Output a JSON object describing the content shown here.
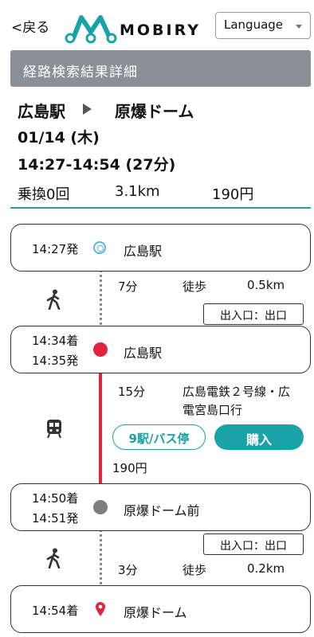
{
  "header": {
    "back_label": "<戻る",
    "brand": "MOBIRY",
    "language_label": "Language",
    "accent_color": "#19a2a8"
  },
  "title_bar": "経路検索結果詳細",
  "summary": {
    "from": "広島駅",
    "to": "原爆ドーム",
    "date": "01/14 (木)",
    "time_range": "14:27-14:54 (27分)",
    "transfers": "乗換0回",
    "distance": "3.1km",
    "fare": "190円"
  },
  "stops": [
    {
      "t1": "14:27発",
      "t2": "",
      "name": "広島駅",
      "marker": "origin-ring-icon"
    },
    {
      "t1": "14:34着",
      "t2": "14:35発",
      "name": "広島駅",
      "marker": "red-dot-icon"
    },
    {
      "t1": "14:50着",
      "t2": "14:51発",
      "name": "原爆ドーム前",
      "marker": "gray-dot-icon"
    },
    {
      "t1": "14:54着",
      "t2": "",
      "name": "原爆ドーム",
      "marker": "red-pin-icon"
    }
  ],
  "segments": {
    "walk1": {
      "duration": "7分",
      "mode": "徒歩",
      "distance": "0.5km",
      "exit": "出入口：出口"
    },
    "tram": {
      "duration": "15分",
      "line_1": "広島電鉄２号線・広",
      "line_2": "電宮島口行",
      "stops_button": "9駅/バス停",
      "buy_button": "購入",
      "fare": "190円"
    },
    "walk2": {
      "duration": "3分",
      "mode": "徒歩",
      "distance": "0.2km",
      "exit": "出入口：出口"
    }
  }
}
